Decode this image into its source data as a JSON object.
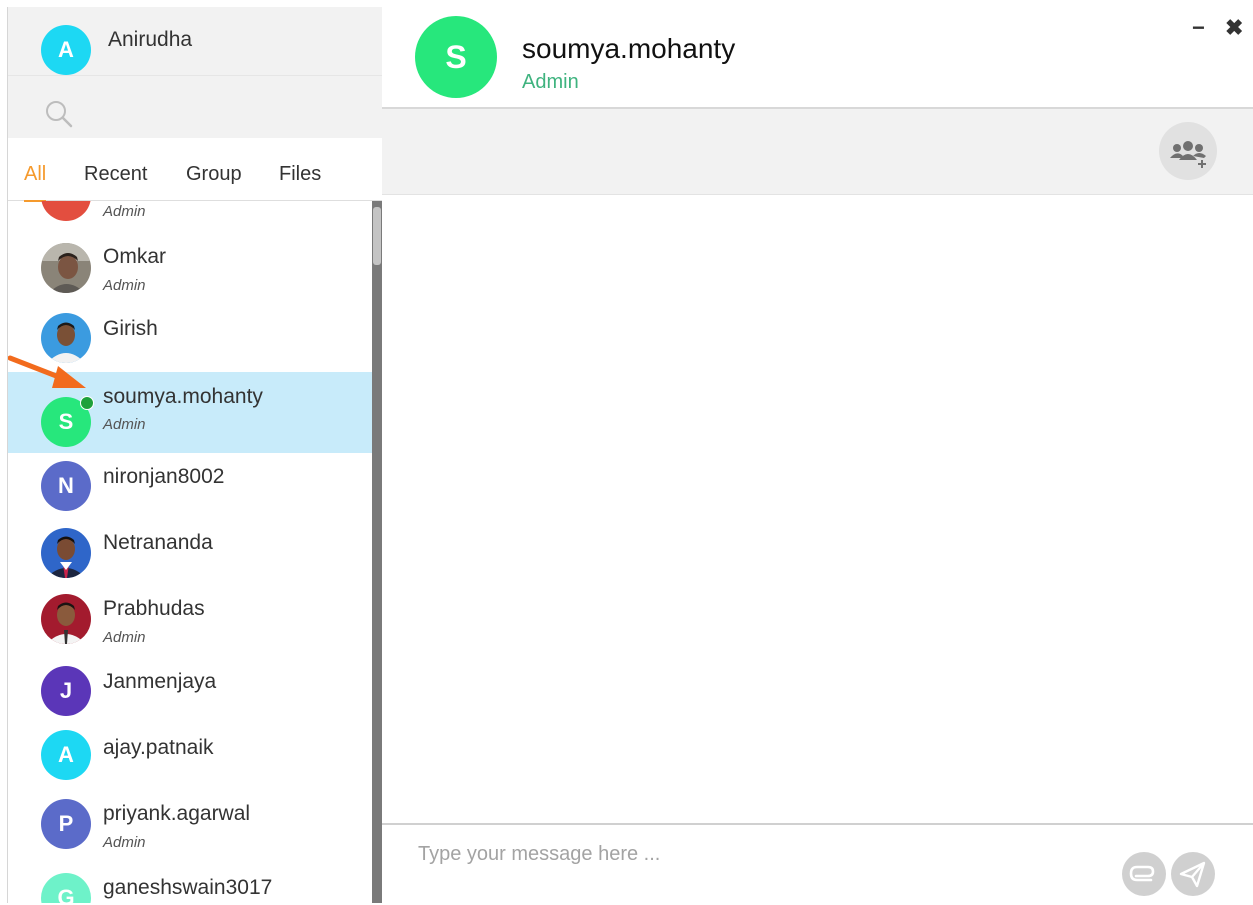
{
  "me": {
    "name": "Anirudha",
    "initial": "A",
    "color": "#1dd8f3"
  },
  "search": {
    "placeholder": ""
  },
  "tabs": [
    {
      "label": "All",
      "active": true
    },
    {
      "label": "Recent",
      "active": false
    },
    {
      "label": "Group",
      "active": false
    },
    {
      "label": "Files",
      "active": false
    }
  ],
  "contacts": [
    {
      "name": "",
      "sub": "Admin",
      "color": "#e34e3f"
    },
    {
      "name": "Omkar",
      "sub": "Admin",
      "photo": true
    },
    {
      "name": "Girish",
      "sub": "",
      "photo": true
    },
    {
      "name": "soumya.mohanty",
      "sub": "Admin",
      "initial": "S",
      "color": "#27e77c",
      "selected": true,
      "online": true
    },
    {
      "name": "nironjan8002",
      "sub": "",
      "initial": "N",
      "color": "#5b6bc9"
    },
    {
      "name": "Netrananda",
      "sub": "",
      "photo": true
    },
    {
      "name": "Prabhudas",
      "sub": "Admin",
      "photo": true
    },
    {
      "name": "Janmenjaya",
      "sub": "",
      "initial": "J",
      "color": "#5b36b8"
    },
    {
      "name": "ajay.patnaik",
      "sub": "",
      "initial": "A",
      "color": "#1dd8f3"
    },
    {
      "name": "priyank.agarwal",
      "sub": "Admin",
      "initial": "P",
      "color": "#5b6bc9"
    },
    {
      "name": "ganeshswain3017",
      "sub": "",
      "initial": "G",
      "color": "#6ef2c9"
    }
  ],
  "chat": {
    "title": "soumya.mohanty",
    "role": "Admin",
    "initial": "S",
    "color": "#27e77c",
    "minimize_label": "−",
    "close_label": "✖"
  },
  "composer": {
    "placeholder": "Type your message here ..."
  },
  "icons": {
    "search": "search-icon",
    "group_add": "group-add-icon",
    "attach": "paperclip-icon",
    "send": "send-icon",
    "annotation": "arrow-annotation-icon"
  },
  "accent": "#f59a2d"
}
